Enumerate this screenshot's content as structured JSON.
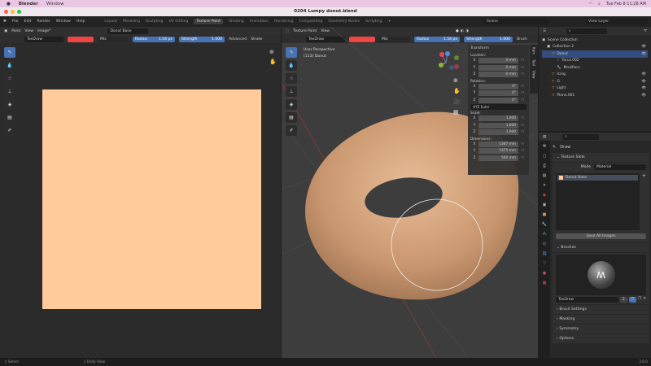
{
  "mac": {
    "app": "Blender",
    "menu": "Window",
    "clock": "Tue Feb 8  11:28 AM"
  },
  "window_title": "0204 Lumpy donut.blend",
  "menu": [
    "File",
    "Edit",
    "Render",
    "Window",
    "Help"
  ],
  "workspaces": [
    "Layout",
    "Modeling",
    "Sculpting",
    "UV Editing",
    "Texture Paint",
    "Shading",
    "Animation",
    "Rendering",
    "Compositing",
    "Geometry Nodes",
    "Scripting"
  ],
  "active_workspace": "Texture Paint",
  "scene": "Scene",
  "view_layer": "View Layer",
  "image_editor": {
    "mode": "Paint",
    "view": "View",
    "image": "Image*",
    "image_name": "Donut Base",
    "brush": "TexDraw",
    "blend": "Mix",
    "radius_label": "Radius",
    "radius": "1.54 px",
    "strength_label": "Strength",
    "strength": "1.000",
    "advanced": "Advanced",
    "stroke": "Stroke",
    "canvas_color": "#ffcb9b",
    "brush_color": "#f04545"
  },
  "viewport": {
    "mode": "Texture Paint",
    "view": "View",
    "brush": "TexDraw",
    "blend": "Mix",
    "radius_label": "Radius",
    "radius": "1.54 px",
    "strength_label": "Strength",
    "strength": "1.000",
    "brush_menu": "Brush",
    "overlay_line1": "User Perspective",
    "overlay_line2": "(113) Donut"
  },
  "npanel": {
    "title": "Transform",
    "location": "Location:",
    "loc": [
      [
        "X",
        "0 mm"
      ],
      [
        "Y",
        "0 mm"
      ],
      [
        "Z",
        "0 mm"
      ]
    ],
    "rotation": "Rotation:",
    "rot": [
      [
        "X",
        "0°"
      ],
      [
        "Y",
        "0°"
      ],
      [
        "Z",
        "0°"
      ]
    ],
    "euler": "XYZ Euler",
    "scale": "Scale:",
    "scl": [
      [
        "X",
        "1.000"
      ],
      [
        "Y",
        "1.000"
      ],
      [
        "Z",
        "1.000"
      ]
    ],
    "dimensions": "Dimensions:",
    "dim": [
      [
        "X",
        "1387 mm"
      ],
      [
        "Y",
        "1375 mm"
      ],
      [
        "Z",
        "560 mm"
      ]
    ],
    "tabs": [
      "Item",
      "Tool",
      "View"
    ]
  },
  "outliner": {
    "root": "Scene Collection",
    "items": [
      "Collection 2",
      "Donut",
      "Torus.002",
      "Modifiers",
      "Icing",
      "G",
      "Light",
      "Plane.001"
    ]
  },
  "properties": {
    "tool": "Draw",
    "texture_slots": "Texture Slots",
    "mode_label": "Mode",
    "mode": "Material",
    "slot": "Donut Base",
    "save_all": "Save All Images",
    "brushes": "Brushes",
    "brush_name": "TexDraw",
    "brush_users": "2",
    "sections": [
      "Brush Settings",
      "Masking",
      "Symmetry",
      "Options"
    ]
  },
  "status": {
    "select": "Select",
    "dolly": "Dolly View",
    "version": "3.0.0"
  }
}
